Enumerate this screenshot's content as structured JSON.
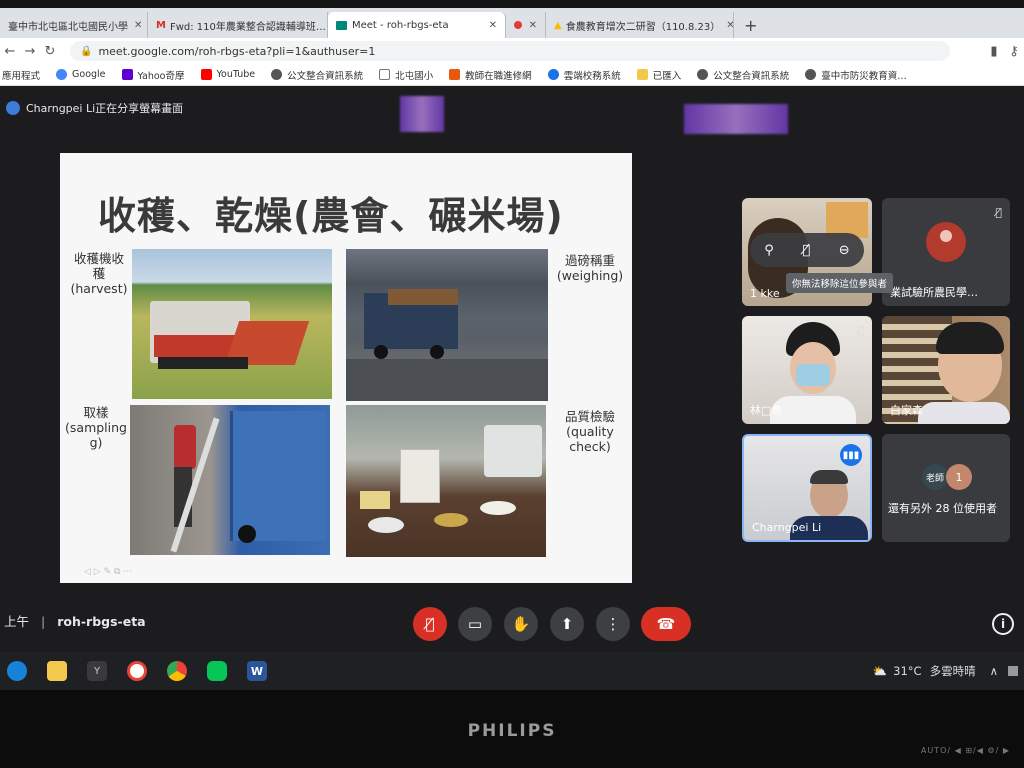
{
  "browser": {
    "tabs": [
      {
        "title": "臺中市北屯區北屯國民小學",
        "icon_color": "#1a73e8"
      },
      {
        "title": "Fwd: 110年農業整合認識輔導班…",
        "icon_color": "#d93025"
      },
      {
        "title": "Meet - roh-rbgs-eta",
        "icon_color": "#00897b",
        "active": true
      },
      {
        "title": "",
        "icon_color": "#e53935"
      },
      {
        "title": "食農教育增次二研習（110.8.23）",
        "icon_color": "#fbbc04"
      }
    ],
    "new_tab": "+",
    "url": "meet.google.com/roh-rbgs-eta?pli=1&authuser=1",
    "bookmarks": [
      {
        "label": "應用程式",
        "color": "#5f6368"
      },
      {
        "label": "Google",
        "color": "#4285f4"
      },
      {
        "label": "Yahoo奇摩",
        "color": "#6001d2"
      },
      {
        "label": "YouTube",
        "color": "#ff0000"
      },
      {
        "label": "公文整合資訊系統",
        "color": "#555555"
      },
      {
        "label": "北屯國小",
        "color": "#777777"
      },
      {
        "label": "教師在職進修網",
        "color": "#e8590c"
      },
      {
        "label": "雲端校務系統",
        "color": "#1a73e8"
      },
      {
        "label": "已匯入",
        "color": "#f2c94c"
      },
      {
        "label": "公文整合資訊系統",
        "color": "#555555"
      },
      {
        "label": "臺中市防災教育資…",
        "color": "#555555"
      }
    ]
  },
  "meet": {
    "sharing_notice": "Charngpei Li正在分享螢幕畫面",
    "slide": {
      "title": "收穫、乾燥(農會、碾米場)",
      "labels": [
        {
          "text": "收穫機收\n穫\n(harvest)"
        },
        {
          "text": "過磅稱重\n(weighing)"
        },
        {
          "text": "取樣\n(sampling\ng)"
        },
        {
          "text": "品質檢驗\n(quality\ncheck)"
        }
      ]
    },
    "participants": [
      {
        "name": "1 kke",
        "muted": false
      },
      {
        "name": "業試驗所農民學…",
        "muted": true
      },
      {
        "name": "林□希",
        "muted": true
      },
      {
        "name": "白家森",
        "muted": true
      },
      {
        "name": "Charngpei Li",
        "speaking": true
      },
      {
        "name": "還有另外 28 位使用者",
        "count_badge": "1",
        "avatar_text": "老師"
      }
    ],
    "hover_tooltip": "你無法移除這位參與者",
    "time": "上午",
    "meeting_code": "roh-rbgs-eta",
    "separator": "|"
  },
  "taskbar": {
    "weather_temp": "31°C",
    "weather_text": "多雲時晴",
    "apps": [
      {
        "name": "edge",
        "color": "#1683d8"
      },
      {
        "name": "file-explorer",
        "color": "#f2c94c"
      },
      {
        "name": "yahoo",
        "color": "#3a3a3a"
      },
      {
        "name": "google",
        "color": "#ffffff"
      },
      {
        "name": "chrome",
        "color": "#34a853"
      },
      {
        "name": "line",
        "color": "#06c755"
      },
      {
        "name": "word",
        "color": "#2b579a"
      }
    ]
  },
  "monitor": {
    "brand": "PHILIPS",
    "osd_labels": "AUTO/ ◀ ⊞/◀ ⚙/ ▶"
  }
}
